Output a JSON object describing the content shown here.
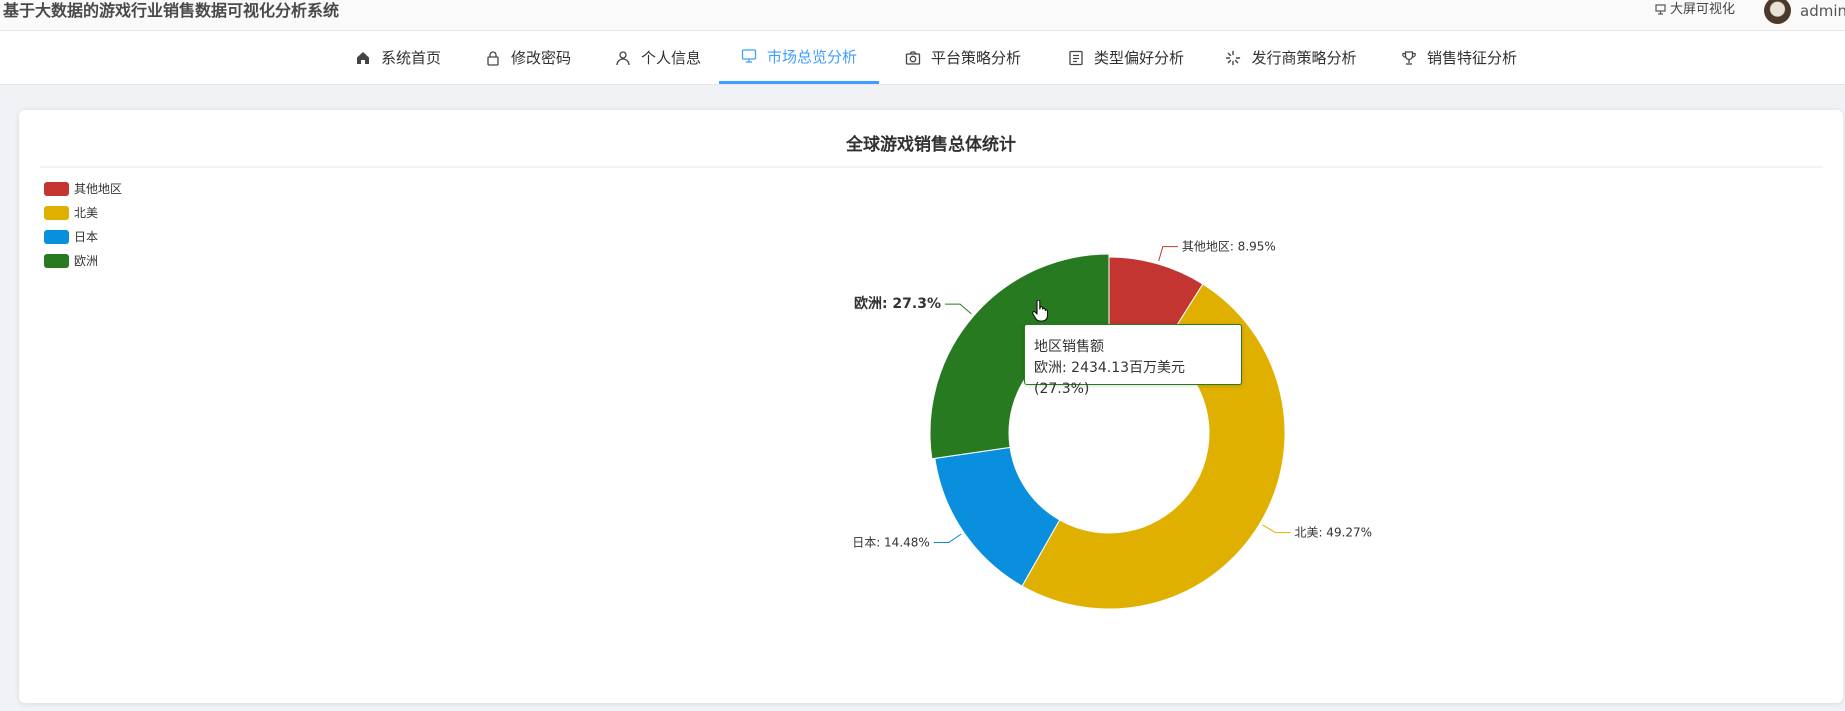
{
  "app": {
    "title": "基于大数据的游戏行业销售数据可视化分析系统",
    "bigscreen_label": "大屏可视化",
    "username": "admin"
  },
  "nav": {
    "tabs": [
      {
        "label": "系统首页",
        "icon": "home-icon"
      },
      {
        "label": "修改密码",
        "icon": "lock-icon"
      },
      {
        "label": "个人信息",
        "icon": "user-icon"
      },
      {
        "label": "市场总览分析",
        "icon": "monitor-icon",
        "active": true
      },
      {
        "label": "平台策略分析",
        "icon": "camera-icon"
      },
      {
        "label": "类型偏好分析",
        "icon": "document-icon"
      },
      {
        "label": "发行商策略分析",
        "icon": "loading-icon"
      },
      {
        "label": "销售特征分析",
        "icon": "trophy-icon"
      }
    ],
    "accent_color": "#409eff"
  },
  "chart_data": {
    "type": "pie",
    "title": "全球游戏销售总体统计",
    "donut": true,
    "legend_position": "top-left",
    "categories": [
      "其他地区",
      "北美",
      "日本",
      "欧洲"
    ],
    "values": [
      8.95,
      49.27,
      14.48,
      27.3
    ],
    "labels": [
      "其他地区: 8.95%",
      "北美: 49.27%",
      "日本: 14.48%",
      "欧洲: 27.3%"
    ],
    "colors": [
      "#c23531",
      "#e0b000",
      "#0a8fde",
      "#277a1f"
    ],
    "emphasized": "欧洲",
    "tooltip": {
      "title": "地区销售额",
      "text": "欧洲: 2434.13百万美元 (27.3%)"
    }
  }
}
